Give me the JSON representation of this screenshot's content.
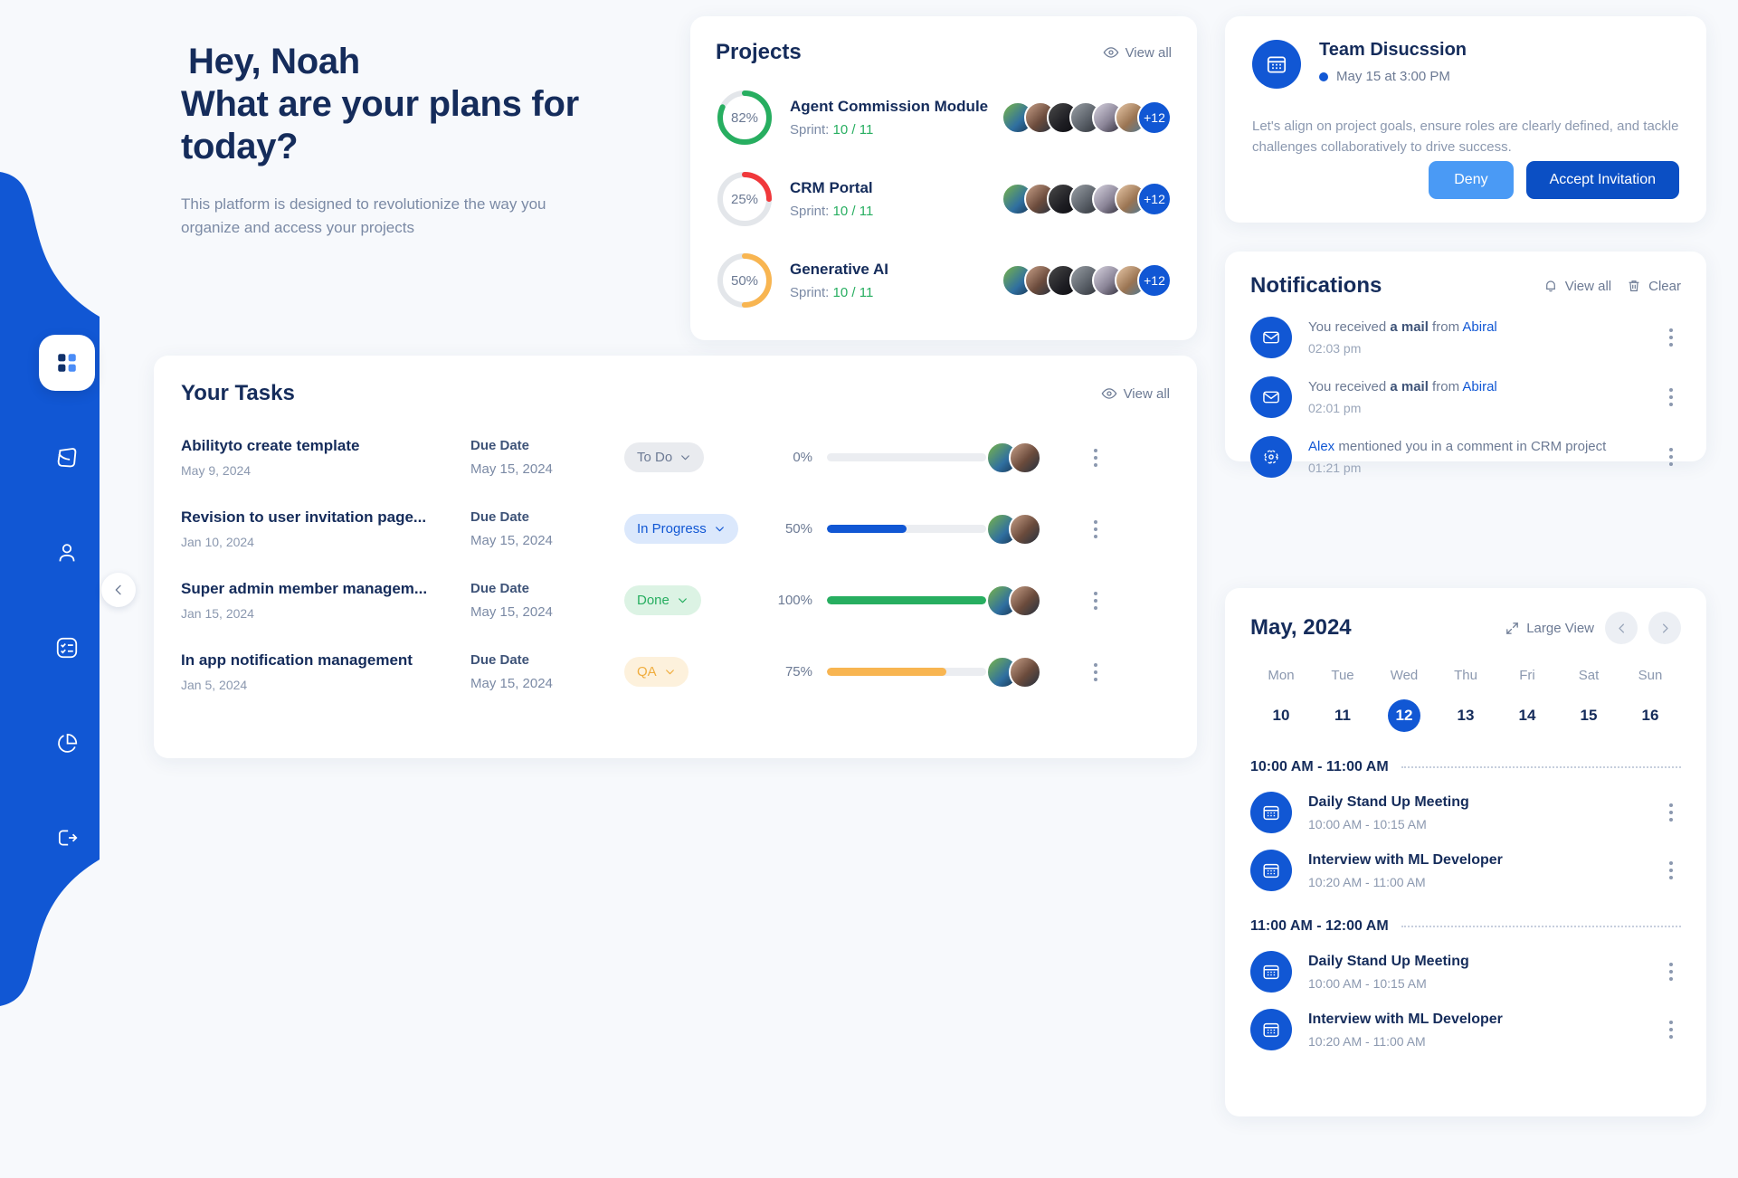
{
  "theme": {
    "accent": "#1157d4",
    "bg": "#f7f9fc",
    "heading": "#152c5b",
    "muted": "#7b8aa5"
  },
  "sidebar": {
    "items": [
      {
        "name": "dashboard",
        "icon": "grid-icon",
        "active": true
      },
      {
        "name": "projects",
        "icon": "layers-icon",
        "active": false
      },
      {
        "name": "users",
        "icon": "user-icon",
        "active": false
      },
      {
        "name": "tasks",
        "icon": "checklist-icon",
        "active": false
      },
      {
        "name": "analytics",
        "icon": "pie-chart-icon",
        "active": false
      },
      {
        "name": "logout",
        "icon": "logout-icon",
        "active": false
      }
    ],
    "collapse_icon": "chevron-left-icon"
  },
  "hero": {
    "greeting": "Hey, Noah",
    "question": "What are your plans for today?",
    "subtitle": "This platform is designed to revolutionize the way you organize and access your projects"
  },
  "projects": {
    "title": "Projects",
    "view_all": "View all",
    "view_all_icon": "eye-icon",
    "items": [
      {
        "name": "Agent Commission Module",
        "percent": 82,
        "percent_label": "82%",
        "color": "#27ae60",
        "sprint_label": "Sprint:",
        "sprint_value": "10 / 11",
        "extra_members": "+12"
      },
      {
        "name": "CRM Portal",
        "percent": 25,
        "percent_label": "25%",
        "color": "#f0383b",
        "sprint_label": "Sprint:",
        "sprint_value": "10 / 11",
        "extra_members": "+12"
      },
      {
        "name": "Generative AI",
        "percent": 50,
        "percent_label": "50%",
        "color": "#f8b551",
        "sprint_label": "Sprint:",
        "sprint_value": "10 / 11",
        "extra_members": "+12"
      }
    ]
  },
  "tasks": {
    "title": "Your Tasks",
    "view_all": "View all",
    "view_all_icon": "eye-icon",
    "due_label": "Due Date",
    "rows": [
      {
        "title": "Abilityto create template",
        "date": "May 9, 2024",
        "due": "May 15, 2024",
        "status": "To Do",
        "status_bg": "#e9ebef",
        "status_fg": "#6c7a94",
        "percent_label": "0%",
        "percent": 0,
        "bar_color": "#ebedf1"
      },
      {
        "title": "Revision to user invitation page...",
        "date": "Jan 10, 2024",
        "due": "May 15, 2024",
        "status": "In Progress",
        "status_bg": "#dbe8fc",
        "status_fg": "#1157d4",
        "percent_label": "50%",
        "percent": 50,
        "bar_color": "#1157d4"
      },
      {
        "title": "Super admin member managem...",
        "date": "Jan 15, 2024",
        "due": "May 15, 2024",
        "status": "Done",
        "status_bg": "#dcf3e4",
        "status_fg": "#27ae60",
        "percent_label": "100%",
        "percent": 100,
        "bar_color": "#27ae60"
      },
      {
        "title": "In app notification management",
        "date": "Jan 5, 2024",
        "due": "May 15, 2024",
        "status": "QA",
        "status_bg": "#fdf1dc",
        "status_fg": "#f0ad3e",
        "percent_label": "75%",
        "percent": 75,
        "bar_color": "#f8b551"
      }
    ]
  },
  "team_discussion": {
    "icon": "calendar-icon",
    "title": "Team Disucssion",
    "when": "May 15 at 3:00 PM",
    "description": "Let's align on project goals, ensure roles are clearly defined, and tackle challenges collaboratively to drive success.",
    "deny_label": "Deny",
    "accept_label": "Accept Invitation"
  },
  "notifications": {
    "title": "Notifications",
    "view_all": "View all",
    "view_all_icon": "bell-icon",
    "clear": "Clear",
    "clear_icon": "trash-icon",
    "items": [
      {
        "icon": "mail-icon",
        "prefix": "You received ",
        "bold": "a mail",
        "middle": " from ",
        "link": "Abiral",
        "suffix": "",
        "time": "02:03 pm"
      },
      {
        "icon": "mail-icon",
        "prefix": "You received ",
        "bold": "a mail",
        "middle": " from ",
        "link": "Abiral",
        "suffix": "",
        "time": "02:01 pm"
      },
      {
        "icon": "mention-icon",
        "prefix": "",
        "bold": "",
        "middle": "",
        "link": "Alex",
        "suffix": " mentioned you in a comment in CRM project",
        "time": "01:21 pm"
      }
    ]
  },
  "calendar": {
    "title": "May, 2024",
    "large_view": "Large View",
    "large_view_icon": "expand-icon",
    "prev_icon": "chevron-left-icon",
    "next_icon": "chevron-right-icon",
    "dow": [
      "Mon",
      "Tue",
      "Wed",
      "Thu",
      "Fri",
      "Sat",
      "Sun"
    ],
    "days": [
      {
        "num": "10",
        "selected": false
      },
      {
        "num": "11",
        "selected": false
      },
      {
        "num": "12",
        "selected": true
      },
      {
        "num": "13",
        "selected": false
      },
      {
        "num": "14",
        "selected": false
      },
      {
        "num": "15",
        "selected": false
      },
      {
        "num": "16",
        "selected": false
      }
    ],
    "slots": [
      {
        "label": "10:00 AM - 11:00 AM",
        "events": [
          {
            "icon": "calendar-icon",
            "title": "Daily Stand Up Meeting",
            "time": "10:00 AM - 10:15 AM"
          },
          {
            "icon": "calendar-icon",
            "title": "Interview with ML Developer",
            "time": "10:20 AM - 11:00 AM"
          }
        ]
      },
      {
        "label": "11:00 AM - 12:00 AM",
        "events": [
          {
            "icon": "calendar-icon",
            "title": "Daily Stand Up Meeting",
            "time": "10:00 AM - 10:15 AM"
          },
          {
            "icon": "calendar-icon",
            "title": "Interview with ML Developer",
            "time": "10:20 AM - 11:00 AM"
          }
        ]
      }
    ]
  }
}
